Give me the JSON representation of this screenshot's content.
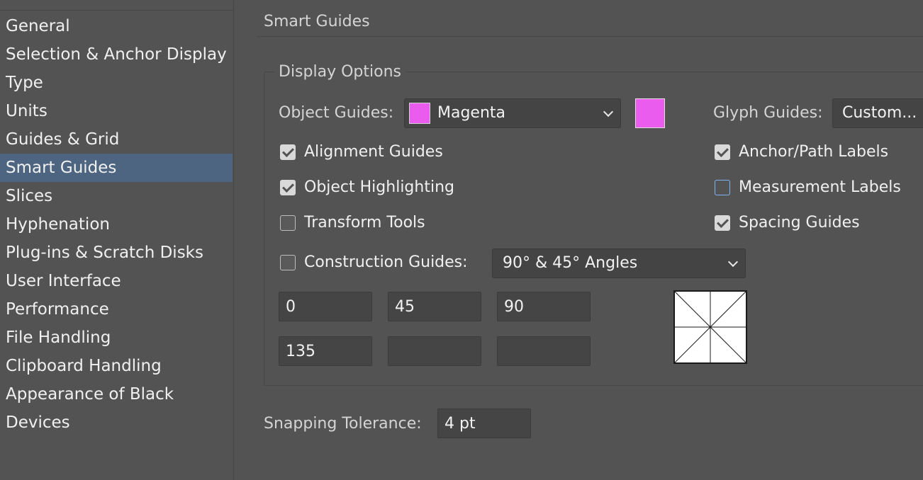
{
  "sidebar": {
    "items": [
      {
        "label": "General"
      },
      {
        "label": "Selection & Anchor Display"
      },
      {
        "label": "Type"
      },
      {
        "label": "Units"
      },
      {
        "label": "Guides & Grid"
      },
      {
        "label": "Smart Guides",
        "selected": true
      },
      {
        "label": "Slices"
      },
      {
        "label": "Hyphenation"
      },
      {
        "label": "Plug-ins & Scratch Disks"
      },
      {
        "label": "User Interface"
      },
      {
        "label": "Performance"
      },
      {
        "label": "File Handling"
      },
      {
        "label": "Clipboard Handling"
      },
      {
        "label": "Appearance of Black"
      },
      {
        "label": "Devices"
      }
    ]
  },
  "main": {
    "title": "Smart Guides",
    "display_options": {
      "group_label": "Display Options",
      "object_guides_label": "Object Guides:",
      "object_guides_value": "Magenta",
      "object_guides_color": "#e95cee",
      "glyph_guides_label": "Glyph Guides:",
      "glyph_guides_value": "Custom...",
      "checks": {
        "alignment_guides": {
          "label": "Alignment Guides",
          "checked": true
        },
        "object_highlighting": {
          "label": "Object Highlighting",
          "checked": true
        },
        "transform_tools": {
          "label": "Transform Tools",
          "checked": false
        },
        "construction_guides": {
          "label": "Construction Guides:",
          "checked": false
        },
        "anchor_path_labels": {
          "label": "Anchor/Path Labels",
          "checked": true
        },
        "measurement_labels": {
          "label": "Measurement Labels",
          "checked": false
        },
        "spacing_guides": {
          "label": "Spacing Guides",
          "checked": true
        }
      },
      "construction_angles_value": "90° & 45° Angles",
      "angles": [
        "0",
        "45",
        "90",
        "135",
        "",
        ""
      ]
    },
    "snapping_tolerance_label": "Snapping Tolerance:",
    "snapping_tolerance_value": "4 pt"
  },
  "colors": {
    "background": "#535353",
    "selection": "#4d6580",
    "magenta": "#e95cee"
  }
}
